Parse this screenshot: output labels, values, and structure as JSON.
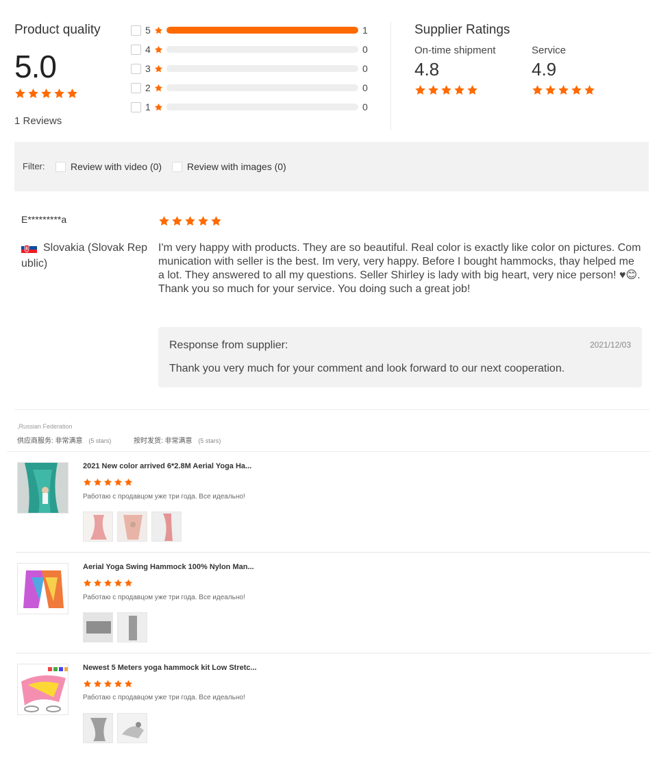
{
  "colors": {
    "accent": "#ff6a00",
    "star": "#ff6a00",
    "bar_track": "#eeeeee"
  },
  "product_quality": {
    "title": "Product quality",
    "score": "5.0",
    "rating_stars": 5,
    "reviews_text": "1 Reviews",
    "distribution": [
      {
        "stars": "5",
        "count": "1",
        "fraction": 1.0
      },
      {
        "stars": "4",
        "count": "0",
        "fraction": 0
      },
      {
        "stars": "3",
        "count": "0",
        "fraction": 0
      },
      {
        "stars": "2",
        "count": "0",
        "fraction": 0
      },
      {
        "stars": "1",
        "count": "0",
        "fraction": 0
      }
    ]
  },
  "supplier_ratings": {
    "title": "Supplier Ratings",
    "items": [
      {
        "label": "On-time shipment",
        "value": "4.8",
        "stars": 5
      },
      {
        "label": "Service",
        "value": "4.9",
        "stars": 5
      }
    ]
  },
  "filter": {
    "label": "Filter:",
    "options": [
      {
        "label": "Review with video (0)",
        "checked": false
      },
      {
        "label": "Review with images (0)",
        "checked": false
      }
    ]
  },
  "review": {
    "reviewer": "E*********a",
    "country": "Slovakia (Slovak Republic)",
    "flag_icon": "slovakia-flag-icon",
    "stars": 5,
    "text": "I'm very happy with products. They are so beautiful. Real color is exactly like color on pictures. Communication with seller is the best. Im very, very happy. Before I bought hammocks, thay helped me a lot. They answered to all my questions. Seller Shirley is lady with big heart, very nice person! ♥😊. Thank you so much for your service. You doing such a great job!",
    "response": {
      "title": "Response from supplier:",
      "date": "2021/12/03",
      "text": "Thank you very much for your comment and look forward to our next cooperation."
    }
  },
  "secondary": {
    "country": ",Russian Federation",
    "service_label": "供应商服务:",
    "service_value": "非常满意",
    "service_stars": "(5 stars)",
    "shipping_label": "按时发货:",
    "shipping_value": "非常满意",
    "shipping_stars": "(5 stars)",
    "products": [
      {
        "title": "2021 New color arrived 6*2.8M Aerial Yoga Ha...",
        "stars": 5,
        "comment": "Работаю с продавцом уже три года. Все идеально!",
        "image_count": 3
      },
      {
        "title": "Aerial Yoga Swing Hammock 100% Nylon Man...",
        "stars": 5,
        "comment": "Работаю с продавцом уже три года. Все идеально!",
        "image_count": 2
      },
      {
        "title": "Newest 5 Meters yoga hammock kit Low Stretc...",
        "stars": 5,
        "comment": "Работаю с продавцом уже три года. Все идеально!",
        "image_count": 2
      }
    ]
  }
}
